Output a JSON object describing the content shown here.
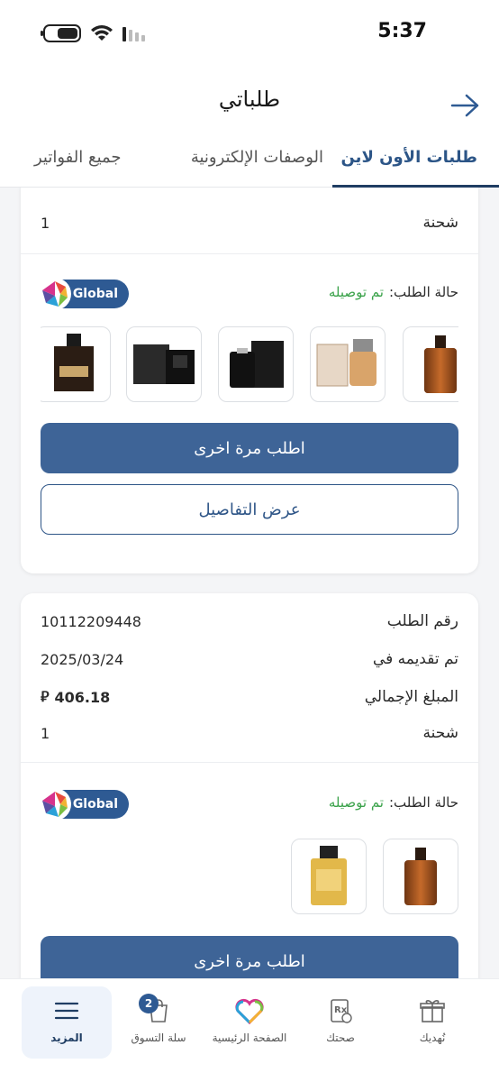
{
  "status_bar": {
    "time": "5:37",
    "battery_level": 0.65
  },
  "header": {
    "title": "طلباتي"
  },
  "tabs": [
    {
      "label": "طلبات الأون لاين",
      "active": true
    },
    {
      "label": "الوصفات الإلكترونية",
      "active": false
    },
    {
      "label": "جميع الفواتير",
      "active": false
    }
  ],
  "orders": [
    {
      "shipments_label": "شحنة",
      "shipments_value": "1",
      "status_label": "حالة الطلب:",
      "status_value": "تم توصيله",
      "store_badge": "Global",
      "products": [
        "perfume-gucci-guilty",
        "perfume-bentley",
        "perfume-jaguar",
        "perfume-lalique-encre-noire",
        "perfume-givenchy-gentleman"
      ],
      "reorder_label": "اطلب مرة اخرى",
      "details_label": "عرض التفاصيل"
    },
    {
      "order_number_label": "رقم الطلب",
      "order_number_value": "10112209448",
      "submitted_label": "تم تقديمه في",
      "submitted_value": "2025/03/24",
      "total_label": "المبلغ الإجمالي",
      "total_value": "406.18",
      "currency_symbol": "⃁",
      "shipments_label": "شحنة",
      "shipments_value": "1",
      "status_label": "حالة الطلب:",
      "status_value": "تم توصيله",
      "store_badge": "Global",
      "products": [
        "perfume-gucci-guilty",
        "perfume-dunhill"
      ],
      "reorder_label": "اطلب مرة اخرى"
    }
  ],
  "bottom_nav": [
    {
      "label": "نُهديك",
      "icon": "gift-icon",
      "active": false
    },
    {
      "label": "صحتك",
      "icon": "prescription-icon",
      "active": false
    },
    {
      "label": "الصفحة الرئيسية",
      "icon": "home-heart-icon",
      "active": false
    },
    {
      "label": "سلة التسوق",
      "icon": "cart-icon",
      "active": false,
      "badge": "2"
    },
    {
      "label": "المزيد",
      "icon": "menu-icon",
      "active": true
    }
  ],
  "colors": {
    "primary": "#3e6497",
    "accent_dark": "#1f3d63",
    "status_green": "#3aa24a"
  }
}
